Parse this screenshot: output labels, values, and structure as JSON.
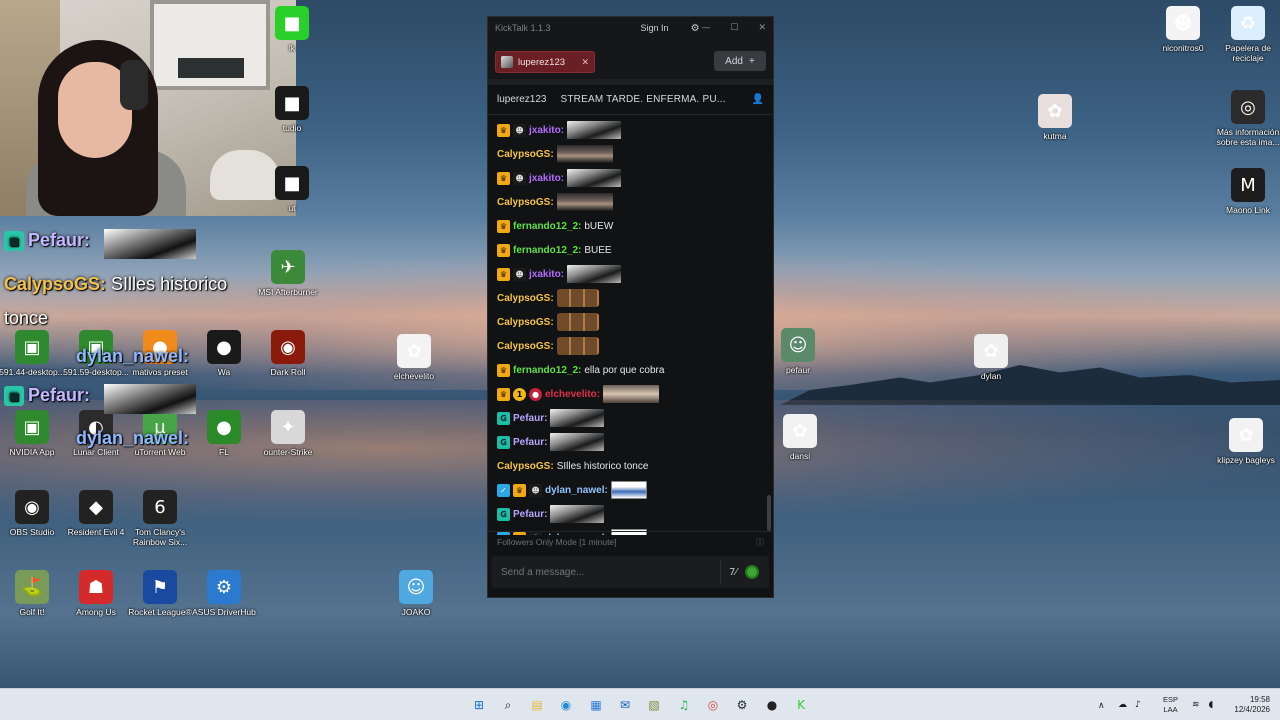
{
  "desktop": {
    "icons": [
      {
        "label": "niconitros0",
        "glyph": "☻",
        "color": "#f4f4f4"
      },
      {
        "label": "Papelera de reciclaje",
        "glyph": "♻",
        "color": "#dcefff"
      },
      {
        "label": "kutma",
        "glyph": "✿",
        "color": "#e8dede"
      },
      {
        "label": "Más información sobre esta ima...",
        "glyph": "◎",
        "color": "#2b2b2b"
      },
      {
        "label": "Maono Link",
        "glyph": "M",
        "color": "#1d1d1d"
      },
      {
        "label": "klipzey bagleys",
        "glyph": "✿",
        "color": "#f2f2f2"
      },
      {
        "label": "pefaur",
        "glyph": "☺",
        "color": "#5a8a6a"
      },
      {
        "label": "dylan",
        "glyph": "✿",
        "color": "#efefef"
      },
      {
        "label": "dansi",
        "glyph": "✿",
        "color": "#f2f2f2"
      },
      {
        "label": "elchevelito",
        "glyph": "✿",
        "color": "#f3f3f3"
      },
      {
        "label": "JOAKO",
        "glyph": "☺",
        "color": "#4fa8e0"
      },
      {
        "label": "MSI Afterburner",
        "glyph": "✈",
        "color": "#3a8a3a"
      },
      {
        "label": "Dark Roll",
        "glyph": "◉",
        "color": "#8a1a0a"
      },
      {
        "label": "ounter-Strike",
        "glyph": "✦",
        "color": "#d8d8d8"
      },
      {
        "label": "591.44-desktop...",
        "glyph": "▣",
        "color": "#2f8a2f"
      },
      {
        "label": "591.59-desktop...",
        "glyph": "▣",
        "color": "#2f8a2f"
      },
      {
        "label": "mativos preset",
        "glyph": "●",
        "color": "#f08a1a"
      },
      {
        "label": "Wa",
        "glyph": "●",
        "color": "#1a1a1a"
      },
      {
        "label": "NVIDIA App",
        "glyph": "▣",
        "color": "#2f8a2f"
      },
      {
        "label": "Lunar Client",
        "glyph": "◐",
        "color": "#2b2b2b"
      },
      {
        "label": "uTorrent Web",
        "glyph": "µ",
        "color": "#47a447"
      },
      {
        "label": "FL",
        "glyph": "●",
        "color": "#2a8a2a"
      },
      {
        "label": "OBS Studio",
        "glyph": "◉",
        "color": "#222222"
      },
      {
        "label": "Resident Evil 4",
        "glyph": "◆",
        "color": "#222222"
      },
      {
        "label": "Tom Clancy's Rainbow Six...",
        "glyph": "6",
        "color": "#222222"
      },
      {
        "label": "Golf It!",
        "glyph": "⛳",
        "color": "#7a9a5a"
      },
      {
        "label": "Among Us",
        "glyph": "☗",
        "color": "#d42a2a"
      },
      {
        "label": "Rocket League®",
        "glyph": "⚑",
        "color": "#1a4aa0"
      },
      {
        "label": "ASUS DriverHub",
        "glyph": "⚙",
        "color": "#2a7ad0"
      },
      {
        "label": "lk",
        "glyph": "■",
        "color": "#2ad02a"
      },
      {
        "label": "tudio",
        "glyph": "■",
        "color": "#1a1a1a"
      },
      {
        "label": "ut",
        "glyph": "■",
        "color": "#1a1a1a"
      }
    ]
  },
  "overlay": {
    "messages": [
      {
        "user": "Pefaur:",
        "text": "",
        "user_color": "#c4b6ff"
      },
      {
        "user": "CalypsoGS:",
        "text": "SIlles historico",
        "user_color": "#f2c14b"
      },
      {
        "user": "",
        "text": "tonce",
        "user_color": "#ffffff"
      },
      {
        "user": "dylan_nawel:",
        "text": "",
        "user_color": "#8fb6ff"
      },
      {
        "user": "Pefaur:",
        "text": "",
        "user_color": "#c4b6ff"
      },
      {
        "user": "dylan_nawel:",
        "text": "",
        "user_color": "#8fb6ff"
      }
    ]
  },
  "kicktalk": {
    "app_title": "KickTalk 1.1.3",
    "signin_label": "Sign In",
    "gear_glyph": "⚙",
    "min_glyph": "—",
    "max_glyph": "☐",
    "close_glyph": "✕",
    "tab": {
      "label": "luperez123",
      "close": "✕"
    },
    "add_label": "Add",
    "add_glyph": "+",
    "channel": {
      "name": "luperez123",
      "title": "STREAM TARDE. ENFERMA. PU...",
      "user_glyph": "👤"
    },
    "messages": [
      {
        "badges": [
          "crown",
          "mask"
        ],
        "user": "jxakito:",
        "user_color": "#b56cff",
        "text": "",
        "emote": "bw"
      },
      {
        "badges": [],
        "user": "CalypsoGS:",
        "user_color": "#f5c44a",
        "text": "",
        "emote": "face"
      },
      {
        "badges": [
          "crown",
          "mask"
        ],
        "user": "jxakito:",
        "user_color": "#b56cff",
        "text": "",
        "emote": "bw"
      },
      {
        "badges": [],
        "user": "CalypsoGS:",
        "user_color": "#f5c44a",
        "text": "",
        "emote": "face"
      },
      {
        "badges": [
          "crown"
        ],
        "user": "fernando12_2:",
        "user_color": "#5fe04b",
        "text": "bUEW",
        "emote": ""
      },
      {
        "badges": [
          "crown"
        ],
        "user": "fernando12_2:",
        "user_color": "#5fe04b",
        "text": "BUEE",
        "emote": ""
      },
      {
        "badges": [
          "crown",
          "mask"
        ],
        "user": "jxakito:",
        "user_color": "#b56cff",
        "text": "",
        "emote": "bw"
      },
      {
        "badges": [],
        "user": "CalypsoGS:",
        "user_color": "#f5c44a",
        "text": "",
        "emote": "monkeys"
      },
      {
        "badges": [],
        "user": "CalypsoGS:",
        "user_color": "#f5c44a",
        "text": "",
        "emote": "monkeys"
      },
      {
        "badges": [],
        "user": "CalypsoGS:",
        "user_color": "#f5c44a",
        "text": "",
        "emote": "monkeys"
      },
      {
        "badges": [
          "crown"
        ],
        "user": "fernando12_2:",
        "user_color": "#5fe04b",
        "text": "ella por que cobra",
        "emote": ""
      },
      {
        "badges": [
          "crown",
          "num",
          "red"
        ],
        "user": "elchevelito:",
        "user_color": "#e0304a",
        "text": "",
        "emote": "photo"
      },
      {
        "badges": [
          "og"
        ],
        "user": "Pefaur:",
        "user_color": "#b8a6ff",
        "text": "",
        "emote": "bw"
      },
      {
        "badges": [
          "og"
        ],
        "user": "Pefaur:",
        "user_color": "#b8a6ff",
        "text": "",
        "emote": "bw"
      },
      {
        "badges": [],
        "user": "CalypsoGS:",
        "user_color": "#f5c44a",
        "text": "SIlles historico tonce",
        "emote": ""
      },
      {
        "badges": [
          "verified",
          "crown",
          "mask"
        ],
        "user": "dylan_nawel:",
        "user_color": "#8fc4ff",
        "text": "",
        "emote": "blue"
      },
      {
        "badges": [
          "og"
        ],
        "user": "Pefaur:",
        "user_color": "#b8a6ff",
        "text": "",
        "emote": "bw"
      },
      {
        "badges": [
          "verified",
          "crown",
          "mask"
        ],
        "user": "dylan_nawel:",
        "user_color": "#8fc4ff",
        "text": "",
        "emote": "blue"
      }
    ],
    "followers_mode": "Followers Only Mode [1 minute]",
    "info_glyph": "ⓘ",
    "input_placeholder": "Send a message...",
    "kick_glyph": "7⁄"
  },
  "taskbar": {
    "apps": [
      {
        "name": "start",
        "glyph": "⊞",
        "color": "#1a6fd6"
      },
      {
        "name": "search",
        "glyph": "⌕",
        "color": "#222222"
      },
      {
        "name": "file-explorer",
        "glyph": "▤",
        "color": "#e8b43a"
      },
      {
        "name": "edge",
        "glyph": "◉",
        "color": "#1f8ad8"
      },
      {
        "name": "store",
        "glyph": "▦",
        "color": "#2a7ad8"
      },
      {
        "name": "outlook",
        "glyph": "✉",
        "color": "#1a5fb8"
      },
      {
        "name": "gallery",
        "glyph": "▧",
        "color": "#7a8a3a"
      },
      {
        "name": "spotify",
        "glyph": "♫",
        "color": "#1db954"
      },
      {
        "name": "chrome",
        "glyph": "◎",
        "color": "#d84a3a"
      },
      {
        "name": "steam",
        "glyph": "⚙",
        "color": "#1b2838"
      },
      {
        "name": "game",
        "glyph": "●",
        "color": "#222222"
      },
      {
        "name": "kicktalk",
        "glyph": "K",
        "color": "#2ad02a"
      }
    ],
    "tray": {
      "chevron": "∧",
      "lang_1": "ESP",
      "lang_2": "LAA",
      "time": "19:58",
      "date": "12/4/2026"
    }
  }
}
